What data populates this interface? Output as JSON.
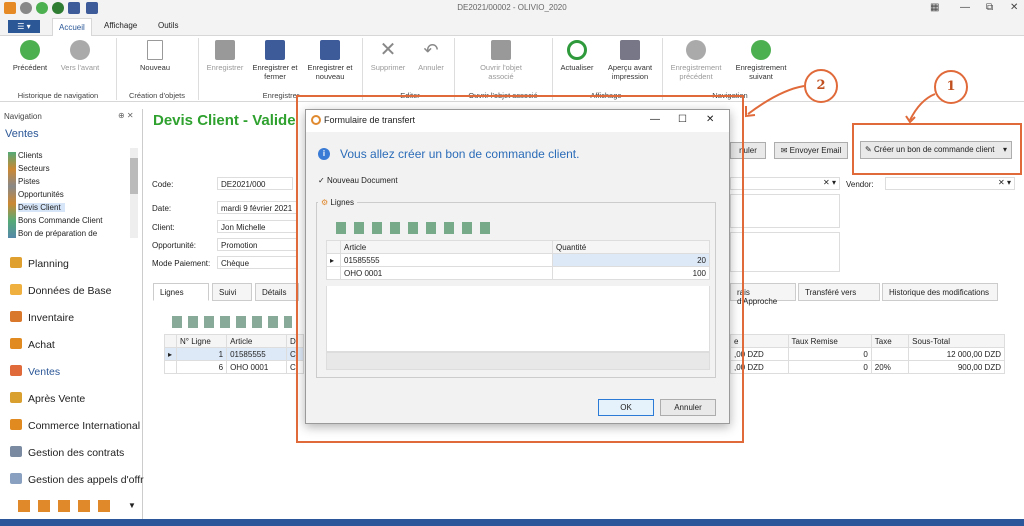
{
  "window": {
    "title": "DE2021/00002 - OLIVIO_2020"
  },
  "ribbon_tabs": [
    "Accueil",
    "Affichage",
    "Outils"
  ],
  "file_button": "☰ ▾",
  "ribbon": {
    "nav": {
      "prev": "Précédent",
      "next": "Vers l'avant",
      "group": "Historique de navigation"
    },
    "create": {
      "new": "Nouveau",
      "group": "Création d'objets"
    },
    "save": {
      "save": "Enregistrer",
      "save_close": "Enregistrer et fermer",
      "save_new": "Enregistrer et nouveau",
      "group": "Enregistrer"
    },
    "edit": {
      "delete": "Supprimer",
      "cancel": "Annuler",
      "group": "Editer"
    },
    "open": {
      "open": "Ouvrir l'objet associé",
      "group": "Ouvrir l'objet associé"
    },
    "display": {
      "refresh": "Actualiser",
      "preview": "Aperçu avant impression",
      "group": "Affichage"
    },
    "navigation": {
      "prev_rec": "Enregistrement précédent",
      "next_rec": "Enregistrement suivant",
      "group": "Navigation"
    }
  },
  "nav_pane": {
    "header": "Navigation",
    "title": "Ventes",
    "items": [
      "Clients",
      "Secteurs",
      "Pistes",
      "Opportunités",
      "Devis Client",
      "Bons Commande Client",
      "Bon de préparation de"
    ],
    "groups": [
      "Planning",
      "Données de Base",
      "Inventaire",
      "Achat",
      "Ventes",
      "Après Vente",
      "Commerce International",
      "Gestion des contrats",
      "Gestion des appels d'offr"
    ]
  },
  "main": {
    "heading": "Devis Client - Valide",
    "actions": {
      "cancel": "nuler",
      "email": "Envoyer Email",
      "create_order": "Créer un bon de commande client"
    },
    "fields": [
      {
        "label": "Code:",
        "value": "DE2021/000"
      },
      {
        "label": "Date:",
        "value": "mardi 9 février 2021"
      },
      {
        "label": "Client:",
        "value": "Jon Michelle"
      },
      {
        "label": "Opportunité:",
        "value": "Promotion"
      },
      {
        "label": "Mode Paiement:",
        "value": "Chèque"
      }
    ],
    "vendor_label": "Vendor:",
    "tabs": [
      "Lignes",
      "Suivi",
      "Détails",
      "rais d'Approche",
      "Transféré vers",
      "Historique des modifications"
    ],
    "grid": {
      "headers": [
        "N° Ligne",
        "Article",
        "D"
      ],
      "rows": [
        [
          "1",
          "01585555",
          "C"
        ],
        [
          "6",
          "OHO 0001",
          "C"
        ]
      ]
    },
    "grid_right": {
      "headers": [
        "e",
        "Taux Remise",
        "Taxe",
        "Sous-Total"
      ],
      "rows": [
        [
          ",00 DZD",
          "0",
          "",
          "12 000,00 DZD"
        ],
        [
          ",00 DZD",
          "0",
          "20%",
          "900,00 DZD"
        ]
      ]
    }
  },
  "annotations": [
    "1",
    "2"
  ],
  "dialog": {
    "title": "Formulaire de transfert",
    "info": "Vous allez créer un bon de commande client.",
    "checkbox_label": "Nouveau Document",
    "checkbox_checked": true,
    "group_label": "Lignes",
    "headers": [
      "Article",
      "Quantité"
    ],
    "rows": [
      [
        "01585555",
        "20"
      ],
      [
        "OHO 0001",
        "100"
      ]
    ],
    "ok": "OK",
    "cancel": "Annuler"
  },
  "colors": {
    "accent": "#2b5797",
    "heading_green": "#2fa12f",
    "annotation": "#e06a3a"
  }
}
